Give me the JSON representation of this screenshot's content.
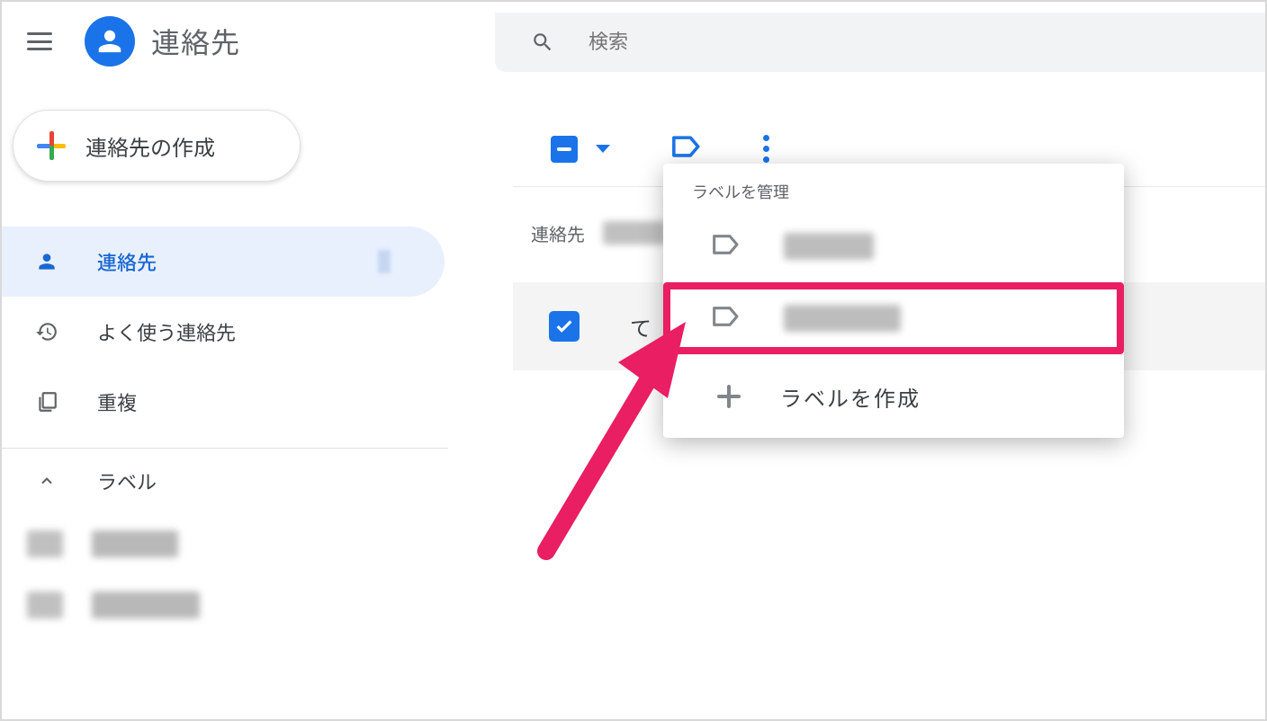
{
  "header": {
    "title": "連絡先"
  },
  "search": {
    "placeholder": "検索"
  },
  "sidebar": {
    "create_label": "連絡先の作成",
    "nav": [
      {
        "label": "連絡先",
        "active": true
      },
      {
        "label": "よく使う連絡先",
        "active": false
      },
      {
        "label": "重複",
        "active": false
      }
    ],
    "section_title": "ラベル"
  },
  "main": {
    "column_header": "連絡先",
    "row_prefix": "て"
  },
  "popup": {
    "title": "ラベルを管理",
    "create_label": "ラベルを作成"
  }
}
